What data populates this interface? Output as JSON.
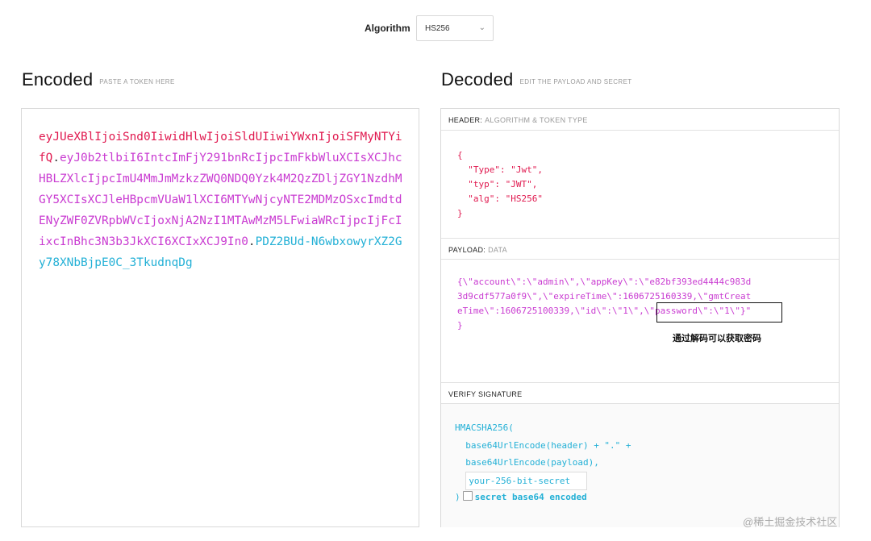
{
  "toolbar": {
    "algorithm_label": "Algorithm",
    "algorithm_value": "HS256"
  },
  "encoded": {
    "title": "Encoded",
    "subtitle": "PASTE A TOKEN HERE",
    "token_header": "eyJUeXBlIjoiSnd0IiwidHlwIjoiSldUIiwiYWxnIjoiSFMyNTYifQ",
    "token_payload": "eyJ0b2tlbiI6IntcImFjY291bnRcIjpcImFkbWluXCIsXCJhcHBLZXlcIjpcImU4MmJmMzkzZWQ0NDQ0Yzk4M2QzZDljZGY1NzdhMGY5XCIsXCJleHBpcmVUaW1lXCI6MTYwNjcyNTE2MDMzOSxcImdtdENyZWF0ZVRpbWVcIjoxNjA2NzI1MTAwMzM5LFwiaWRcIjpcIjFcIixcInBhc3N3b3JkXCI6XCIxXCJ9In0",
    "token_signature": "PDZ2BUd-N6wbxowyrXZ2Gy78XNbBjpE0C_3TkudnqDg",
    "dot": "."
  },
  "decoded": {
    "title": "Decoded",
    "subtitle": "EDIT THE PAYLOAD AND SECRET",
    "header_section": {
      "label": "HEADER:",
      "sublabel": "ALGORITHM & TOKEN TYPE",
      "open_brace": "{",
      "lines": [
        {
          "key": "\"Type\"",
          "colon": ": ",
          "value": "\"Jwt\"",
          "comma": ","
        },
        {
          "key": "\"typ\"",
          "colon": ": ",
          "value": "\"JWT\"",
          "comma": ","
        },
        {
          "key": "\"alg\"",
          "colon": ": ",
          "value": "\"HS256\"",
          "comma": ""
        }
      ],
      "close_brace": "}"
    },
    "payload_section": {
      "label": "PAYLOAD:",
      "sublabel": "DATA",
      "lines": [
        "{\\\"account\\\":\\\"admin\\\",\\\"appKey\\\":\\\"e82bf393ed4444c983d",
        "3d9cdf577a0f9\\\",\\\"expireTime\\\":1606725160339,\\\"gmtCreat",
        "eTime\\\":1606725100339,\\\"id\\\":\\\"1\\\",\\\"password\\\":\\\"1\\\"}\""
      ],
      "close_brace": "}",
      "annotation": "通过解码可以获取密码"
    },
    "signature_section": {
      "label": "VERIFY SIGNATURE",
      "fn": "HMACSHA256(",
      "line1": "base64UrlEncode(header) + \".\" +",
      "line2": "base64UrlEncode(payload),",
      "secret_placeholder": "your-256-bit-secret",
      "close_paren": ")",
      "checkbox_label": "secret base64 encoded"
    }
  },
  "watermark": "@稀土掘金技术社区",
  "colors": {
    "header": "#e0194f",
    "payload": "#c93bd1",
    "signature": "#23b0d6"
  }
}
